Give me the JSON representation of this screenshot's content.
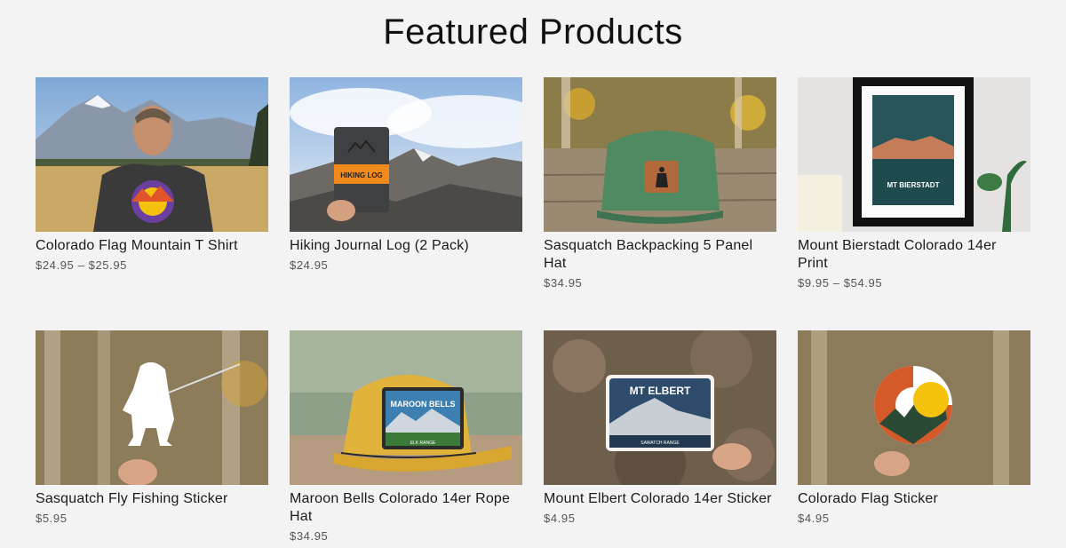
{
  "section": {
    "title": "Featured Products"
  },
  "products": [
    {
      "title": "Colorado Flag Mountain T Shirt",
      "price": "$24.95 – $25.95"
    },
    {
      "title": "Hiking Journal Log (2 Pack)",
      "price": "$24.95",
      "image_text": "HIKING LOG"
    },
    {
      "title": "Sasquatch Backpacking 5 Panel Hat",
      "price": "$34.95"
    },
    {
      "title": "Mount Bierstadt Colorado 14er Print",
      "price": "$9.95 – $54.95",
      "image_text": "MT BIERSTADT"
    },
    {
      "title": "Sasquatch Fly Fishing Sticker",
      "price": "$5.95"
    },
    {
      "title": "Maroon Bells Colorado 14er Rope Hat",
      "price": "$34.95",
      "image_text": "MAROON BELLS",
      "image_subtext": "ELK RANGE"
    },
    {
      "title": "Mount Elbert Colorado 14er Sticker",
      "price": "$4.95",
      "image_text": "MT ELBERT",
      "image_subtext": "SAWATCH RANGE"
    },
    {
      "title": "Colorado Flag Sticker",
      "price": "$4.95"
    }
  ]
}
